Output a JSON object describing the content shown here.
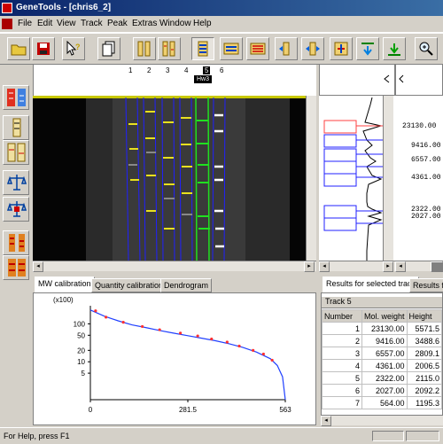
{
  "window": {
    "title": "GeneTools - [chris6_2]"
  },
  "menu": [
    "File",
    "Edit",
    "View",
    "Track",
    "Peak",
    "Extras",
    "Window",
    "Help"
  ],
  "toolbar": {
    "buttons": [
      "open-icon",
      "save-icon",
      "context-help-icon",
      "copy-icon",
      "tracks-icon",
      "lanes-icon",
      "bands-icon",
      "auto-detect-icon",
      "align-icon",
      "sort-icon",
      "compare-icon",
      "merge-icon",
      "move-down-icon",
      "move-up-icon",
      "zoom-icon"
    ]
  },
  "lanes": {
    "numbers": [
      "1",
      "2",
      "3",
      "4",
      "5",
      "6"
    ],
    "selected_label": "Hw3"
  },
  "profile_mw": [
    "23130.00",
    "9416.00",
    "6557.00",
    "4361.00",
    "2322.00",
    "2027.00"
  ],
  "tabs": {
    "mw_calibration": "MW calibration",
    "quantity_calibration": "Quantity calibration",
    "dendrogram": "Dendrogram"
  },
  "results_tabs": {
    "selected": "Results for selected track",
    "all": "Results fo"
  },
  "chart_data": {
    "type": "line",
    "y_scale": "log",
    "ylabel": "(x100)",
    "y_ticks": [
      "100",
      "50",
      "20",
      "10",
      "5"
    ],
    "x_ticks": [
      "0",
      "281.5",
      "563"
    ],
    "xlim": [
      0,
      563
    ],
    "series": [
      {
        "x": [
          0,
          40,
          80,
          120,
          160,
          200,
          240,
          280,
          320,
          360,
          400,
          440,
          480,
          520,
          540,
          555,
          563
        ],
        "y": [
          231.3,
          160,
          120,
          94,
          80,
          67,
          57,
          49,
          42,
          36,
          30,
          24,
          18,
          12,
          8,
          4,
          1
        ]
      }
    ],
    "points": {
      "x": [
        15,
        45,
        95,
        150,
        200,
        260,
        310,
        350,
        395,
        430,
        470,
        500,
        525
      ],
      "y": [
        220,
        150,
        110,
        85,
        70,
        57,
        48,
        40,
        33,
        26,
        20,
        16,
        11
      ]
    }
  },
  "results": {
    "track_label": "Track 5",
    "columns": [
      "Number",
      "Mol. weight",
      "Height"
    ],
    "rows": [
      [
        "1",
        "23130.00",
        "5571.5"
      ],
      [
        "2",
        "9416.00",
        "3488.6"
      ],
      [
        "3",
        "6557.00",
        "2809.1"
      ],
      [
        "4",
        "4361.00",
        "2006.5"
      ],
      [
        "5",
        "2322.00",
        "2115.0"
      ],
      [
        "6",
        "2027.00",
        "2092.2"
      ],
      [
        "7",
        "564.00",
        "1195.3"
      ]
    ]
  },
  "status": {
    "text": "For Help, press F1"
  }
}
